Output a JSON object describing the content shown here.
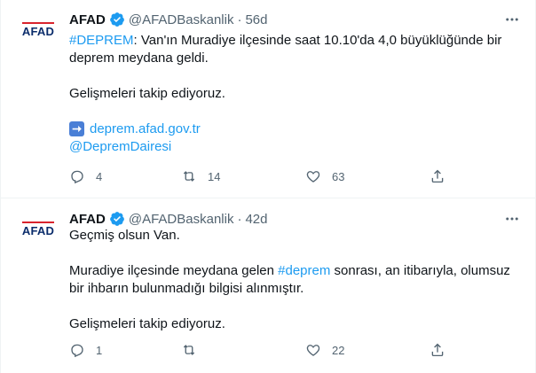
{
  "colors": {
    "link": "#1d9bf0",
    "text": "#0f1419",
    "muted": "#536471",
    "verified": "#1d9bf0",
    "logo_blue": "#0a2c6b",
    "logo_red": "#d9232d"
  },
  "tweets": [
    {
      "avatar_text": "AFAD",
      "name": "AFAD",
      "handle": "@AFADBaskanlik",
      "separator": "·",
      "time": "56d",
      "hashtag": "#DEPREM",
      "line1_rest": ": Van'ın Muradiye ilçesinde saat 10.10'da 4,0 büyüklüğünde bir",
      "line2": "deprem meydana geldi.",
      "line3": "Gelişmeleri takip ediyoruz.",
      "link1": "deprem.afad.gov.tr",
      "link2": "@DepremDairesi",
      "replies": "4",
      "retweets": "14",
      "likes": "63"
    },
    {
      "avatar_text": "AFAD",
      "name": "AFAD",
      "handle": "@AFADBaskanlik",
      "separator": "·",
      "time": "42d",
      "line1": "Geçmiş olsun Van.",
      "line2_pre": "Muradiye ilçesinde meydana gelen ",
      "hashtag": "#deprem",
      "line2_post": " sonrası, an itibarıyla, olumsuz",
      "line3": "bir ihbarın bulunmadığı bilgisi alınmıştır.",
      "line4": "Gelişmeleri takip ediyoruz.",
      "replies": "1",
      "retweets": "",
      "likes": "22"
    }
  ]
}
